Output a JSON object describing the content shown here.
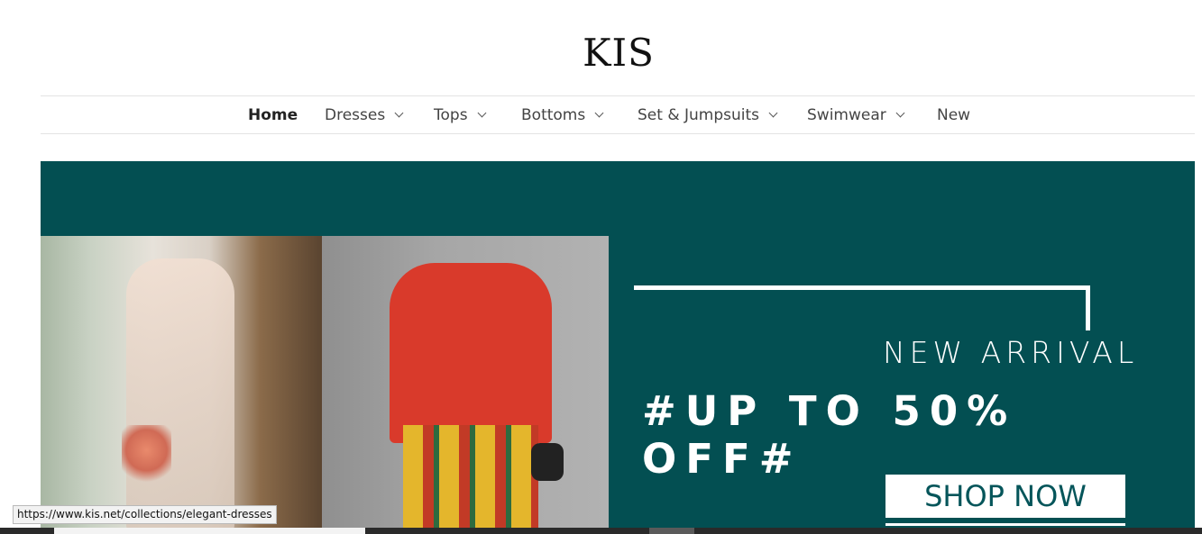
{
  "brand": {
    "logo_text": "KIS"
  },
  "nav": {
    "items": [
      {
        "label": "Home",
        "dropdown": false,
        "active": true
      },
      {
        "label": "Dresses",
        "dropdown": true
      },
      {
        "label": "Tops",
        "dropdown": true
      },
      {
        "label": "Bottoms",
        "dropdown": true
      },
      {
        "label": "Set & Jumpsuits",
        "dropdown": true
      },
      {
        "label": "Swimwear",
        "dropdown": true
      },
      {
        "label": "New",
        "dropdown": false
      }
    ]
  },
  "banner": {
    "background_color": "#034f52",
    "subtitle": "NEW ARRIVAL",
    "headline": "#UP TO 50% OFF#",
    "cta_label": "SHOP NOW"
  },
  "status_bar": {
    "hover_url": "https://www.kis.net/collections/elegant-dresses"
  }
}
